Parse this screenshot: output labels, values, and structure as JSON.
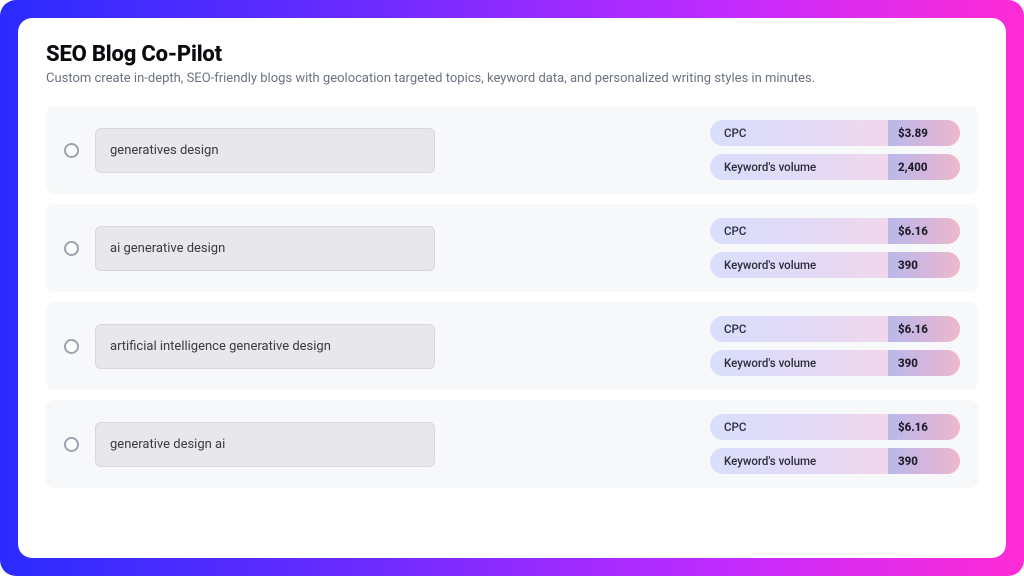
{
  "header": {
    "title": "SEO Blog Co-Pilot",
    "subtitle": "Custom create in-depth, SEO-friendly blogs with geolocation targeted topics, keyword data, and personalized writing styles in minutes."
  },
  "labels": {
    "cpc": "CPC",
    "volume": "Keyword's volume"
  },
  "rows": [
    {
      "keyword": "generatives design",
      "cpc": "$3.89",
      "volume": "2,400"
    },
    {
      "keyword": "ai generative design",
      "cpc": "$6.16",
      "volume": "390"
    },
    {
      "keyword": "artificial intelligence generative design",
      "cpc": "$6.16",
      "volume": "390"
    },
    {
      "keyword": "generative design ai",
      "cpc": "$6.16",
      "volume": "390"
    }
  ]
}
